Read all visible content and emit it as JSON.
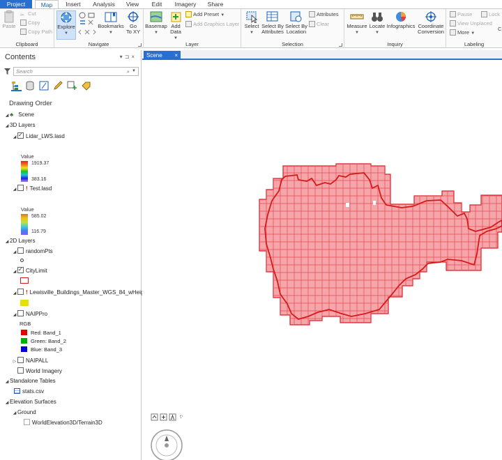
{
  "menu_tabs": [
    "Project",
    "Map",
    "Insert",
    "Analysis",
    "View",
    "Edit",
    "Imagery",
    "Share"
  ],
  "active_tab": "Map",
  "ribbon": {
    "clipboard": {
      "paste": "Paste",
      "cut": "Cut",
      "copy": "Copy",
      "copy_path": "Copy Path",
      "label": "Clipboard"
    },
    "navigate": {
      "explore": "Explore",
      "bookmarks": "Bookmarks",
      "go_to_xy_line1": "Go",
      "go_to_xy_line2": "To XY",
      "label": "Navigate"
    },
    "layer": {
      "basemap": "Basemap",
      "add_data_line1": "Add",
      "add_data_line2": "Data",
      "add_preset": "Add Preset",
      "add_graphics_layer": "Add Graphics Layer",
      "label": "Layer"
    },
    "selection": {
      "select": "Select",
      "select_by_attributes_line1": "Select By",
      "select_by_attributes_line2": "Attributes",
      "select_by_location_line1": "Select By",
      "select_by_location_line2": "Location",
      "attributes": "Attributes",
      "clear": "Clear",
      "label": "Selection"
    },
    "inquiry": {
      "measure": "Measure",
      "locate": "Locate",
      "infographics": "Infographics",
      "coordinate_conversion_line1": "Coordinate",
      "coordinate_conversion_line2": "Conversion",
      "label": "Inquiry"
    },
    "labeling": {
      "pause": "Pause",
      "lock": "Lock",
      "view_unplaced": "View Unplaced",
      "more": "More",
      "truncated": "C",
      "label": "Labeling"
    }
  },
  "contents": {
    "title": "Contents",
    "search_placeholder": "Search",
    "drawing_order": "Drawing Order",
    "scene": "Scene",
    "layers_3d": "3D Layers",
    "lidar_lws": "Lidar_LWS.lasd",
    "value_label_1": "Value",
    "lidar_max": "1919.37",
    "lidar_min": "383.16",
    "test_lasd": "Test.lasd",
    "value_label_2": "Value",
    "test_max": "585.02",
    "test_min": "116.79",
    "layers_2d": "2D Layers",
    "random_pts": "randomPts",
    "city_limit": "CityLimit",
    "buildings": "Lewisville_Buildings_Master_WGS_84_wHeight",
    "naippro": "NAIPPro",
    "rgb": "RGB",
    "red_band": "Red:   Band_1",
    "green_band": "Green:  Band_2",
    "blue_band": "Blue:   Band_3",
    "naipall": "NAIPALL",
    "world_imagery": "World Imagery",
    "standalone_tables": "Standalone Tables",
    "stats_csv": "stats.csv",
    "elevation_surfaces": "Elevation Surfaces",
    "ground": "Ground",
    "terrain": "WorldElevation3D/Terrain3D"
  },
  "colors": {
    "accent": "#2a6fd0",
    "grid_fill": "#f4a6aa",
    "grid_stroke": "#e01b24",
    "city_limit_outline": "#d61a1a",
    "buildings_fill": "#e8e000",
    "red_band": "#e00000",
    "green_band": "#00b000",
    "blue_band": "#0000d0"
  },
  "view": {
    "tab_label": "Scene",
    "close_glyph": "×"
  }
}
